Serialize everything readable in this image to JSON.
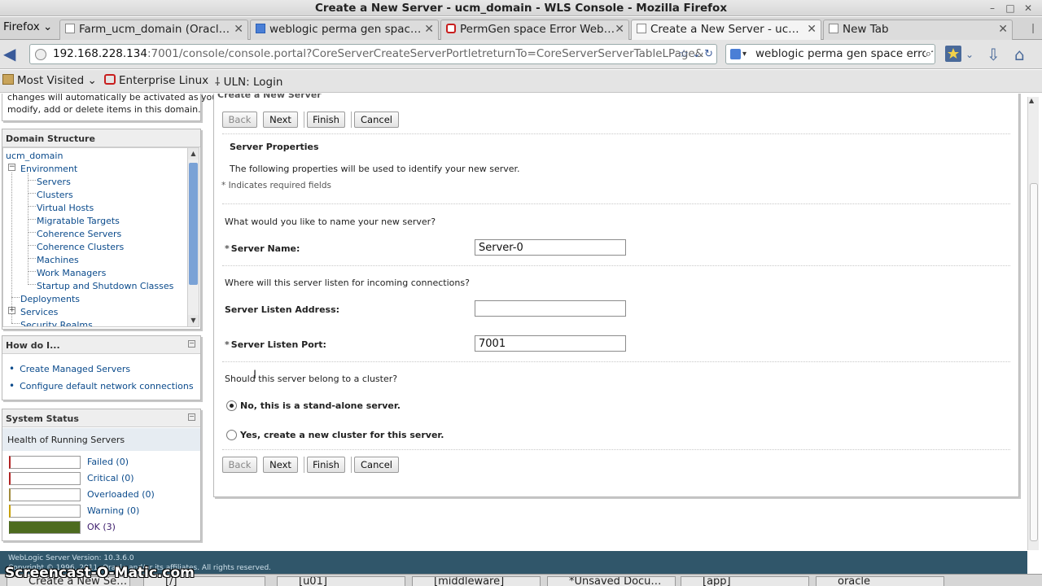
{
  "window": {
    "title": "Create a New Server - ucm_domain - WLS Console - Mozilla Firefox"
  },
  "tabs": {
    "firefox_menu": "Firefox",
    "items": [
      {
        "label": "Farm_ucm_domain (Oracl…"
      },
      {
        "label": "weblogic perma gen spac…"
      },
      {
        "label": "PermGen space Error Web…"
      },
      {
        "label": "Create a New Server - uc…"
      },
      {
        "label": "New Tab"
      }
    ]
  },
  "nav": {
    "url_host": "192.168.228.134",
    "url_path": ":7001/console/console.portal?CoreServerCreateServerPortletreturnTo=CoreServerServerTableLPage&",
    "search_value": "weblogic perma gen space error"
  },
  "bookmarks": {
    "most_visited": "Most Visited",
    "enterprise_linux": "Enterprise Linux",
    "uln_login": "ULN: Login"
  },
  "change_center": {
    "text_line1": "changes will automatically be activated as you",
    "text_line2": "modify, add or delete items in this domain."
  },
  "domain_structure": {
    "title": "Domain Structure",
    "root": "ucm_domain",
    "environment": "Environment",
    "children": [
      "Servers",
      "Clusters",
      "Virtual Hosts",
      "Migratable Targets",
      "Coherence Servers",
      "Coherence Clusters",
      "Machines",
      "Work Managers",
      "Startup and Shutdown Classes"
    ],
    "deployments": "Deployments",
    "services": "Services",
    "security_realms": "Security Realms"
  },
  "how_do_i": {
    "title": "How do I...",
    "links": [
      "Create Managed Servers",
      "Configure default network connections"
    ]
  },
  "system_status": {
    "title": "System Status",
    "subtitle": "Health of Running Servers",
    "rows": [
      {
        "label": "Failed (0)",
        "fill": 0,
        "color": "#b22222"
      },
      {
        "label": "Critical (0)",
        "fill": 0,
        "color": "#b22222"
      },
      {
        "label": "Overloaded (0)",
        "fill": 0,
        "color": "#a08a3c"
      },
      {
        "label": "Warning (0)",
        "fill": 0,
        "color": "#c8a000"
      },
      {
        "label": "OK (3)",
        "fill": 1,
        "color": "#4d6b1f"
      }
    ]
  },
  "form": {
    "header": "Create a New Server",
    "back": "Back",
    "next": "Next",
    "finish": "Finish",
    "cancel": "Cancel",
    "section_title": "Server Properties",
    "description": "The following properties will be used to identify your new server.",
    "required_note": "* Indicates required fields",
    "q_name": "What would you like to name your new server?",
    "server_name_label": "Server Name:",
    "server_name_value": "Server-0",
    "q_listen": "Where will this server listen for incoming connections?",
    "listen_address_label": "Server Listen Address:",
    "listen_address_value": "",
    "listen_port_label": "Server Listen Port:",
    "listen_port_value": "7001",
    "q_cluster": "Should this server belong to a cluster?",
    "radio_standalone": "No, this is a stand-alone server.",
    "radio_cluster": "Yes, create a new cluster for this server."
  },
  "footer": {
    "version": "WebLogic Server Version: 10.3.6.0",
    "copyright": "Copyright © 1996, 2011, Oracle and/or its affiliates. All rights reserved."
  },
  "taskbar": {
    "items": [
      "Create a New Se…",
      "[/]",
      "[u01]",
      "[middleware]",
      "*Unsaved Docu…",
      "[app]",
      "oracle"
    ],
    "watermark": "Screencast-O-Matic.com"
  }
}
